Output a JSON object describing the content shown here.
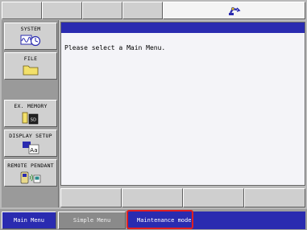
{
  "top_tabs": {
    "count": 6,
    "active_index": 5,
    "active_icon": "robot-arm-icon"
  },
  "left_menu": {
    "items": [
      {
        "label": "SYSTEM",
        "icon": "system-waveform-clock-icon"
      },
      {
        "label": "FILE",
        "icon": "folder-icon"
      },
      {
        "label": "EX. MEMORY",
        "icon": "sd-card-icon"
      },
      {
        "label": "DISPLAY SETUP",
        "icon": "display-font-icon"
      },
      {
        "label": "REMOTE PENDANT",
        "icon": "pendant-icon"
      }
    ]
  },
  "main": {
    "message": "Please select a Main Menu."
  },
  "function_buttons": {
    "count": 4
  },
  "status_bar": {
    "main_menu": "Main Menu",
    "simple_menu": "Simple Menu",
    "maintenance": "Maintenance mode"
  },
  "colors": {
    "header_blue": "#2a2bb0",
    "highlight_red": "#e02020",
    "panel_gray": "#b9b9b9"
  }
}
